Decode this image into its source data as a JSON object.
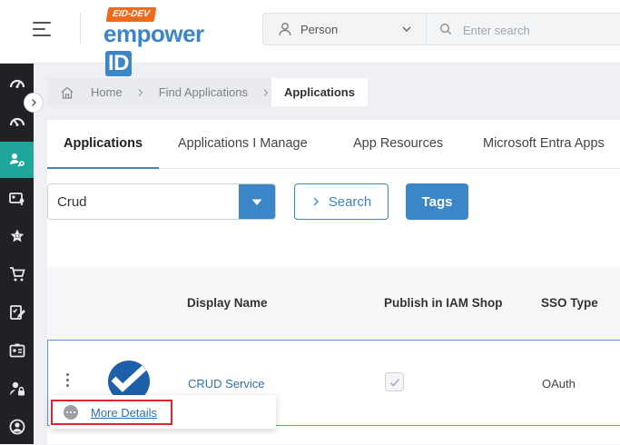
{
  "header": {
    "env_badge": "EID-DEV",
    "logo_text": "empower",
    "logo_id": "ID",
    "person_select": {
      "value": "Person"
    },
    "search": {
      "placeholder": "Enter search"
    }
  },
  "rail": {
    "items": [
      {
        "icon": "dashboard-icon"
      },
      {
        "icon": "dashboard-alt-icon"
      },
      {
        "icon": "user-connect-icon",
        "active": true
      },
      {
        "icon": "id-card-key-icon"
      },
      {
        "icon": "star-badge-icon"
      },
      {
        "icon": "cart-icon"
      },
      {
        "icon": "checklist-edit-icon"
      },
      {
        "icon": "id-card-icon"
      },
      {
        "icon": "user-lock-icon"
      },
      {
        "icon": "user-circle-icon"
      }
    ]
  },
  "breadcrumb": {
    "home": "Home",
    "find": "Find Applications",
    "current": "Applications"
  },
  "tabs": [
    {
      "label": "Applications",
      "active": true
    },
    {
      "label": "Applications I Manage"
    },
    {
      "label": "App Resources"
    },
    {
      "label": "Microsoft Entra Apps"
    }
  ],
  "filter": {
    "combo_value": "Crud",
    "search_label": "Search",
    "tags_label": "Tags"
  },
  "table": {
    "columns": [
      "Display Name",
      "Publish in IAM Shop",
      "SSO Type"
    ],
    "rows": [
      {
        "display_name": "CRUD Service",
        "published": true,
        "sso_type": "OAuth"
      }
    ]
  },
  "row_menu": {
    "items": [
      {
        "label": "More Details",
        "icon": "more-dots-icon"
      }
    ]
  },
  "colors": {
    "accent": "#3a86c8",
    "rail_active": "#1fa59a",
    "badge": "#f06a1e",
    "highlight": "#d9262c"
  }
}
